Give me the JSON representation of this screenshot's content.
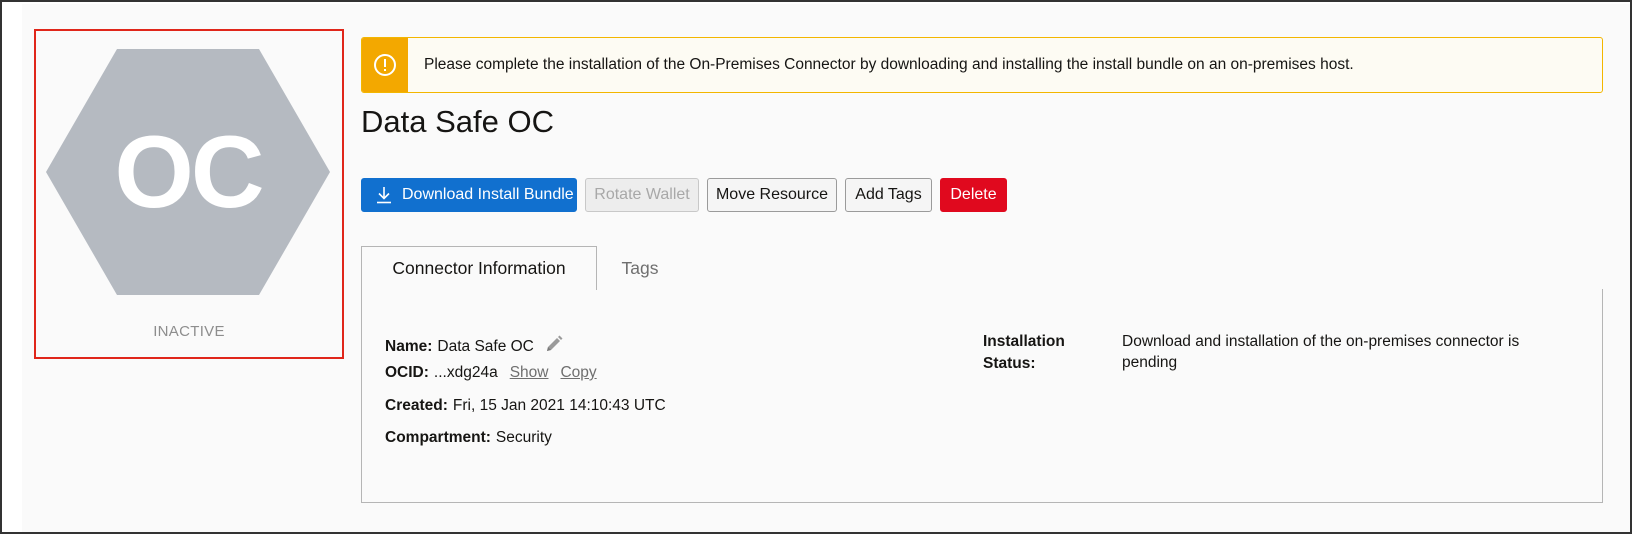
{
  "resource": {
    "initials": "OC",
    "state": "INACTIVE",
    "colors": {
      "hexagon": "#b5bac1",
      "status_border": "#e0261a"
    }
  },
  "banner": {
    "icon": "exclamation-circle-icon",
    "message": "Please complete the installation of the On-Premises Connector by downloading and installing the install bundle on an on-premises host.",
    "colors": {
      "accent": "#f3a800"
    }
  },
  "title": "Data Safe OC",
  "actions": {
    "download_label": "Download Install Bundle",
    "download_icon": "download-icon",
    "rotate_label": "Rotate Wallet",
    "move_label": "Move Resource",
    "tags_label": "Add Tags",
    "delete_label": "Delete",
    "colors": {
      "primary": "#1170cf",
      "danger": "#e0091e"
    }
  },
  "tabs": [
    {
      "label": "Connector Information",
      "active": true
    },
    {
      "label": "Tags",
      "active": false
    }
  ],
  "info": {
    "name_label": "Name:",
    "name_value": "Data Safe OC",
    "edit_icon": "pencil-icon",
    "ocid_label": "OCID:",
    "ocid_value": "...xdg24a",
    "show_label": "Show",
    "copy_label": "Copy",
    "created_label": "Created:",
    "created_value": "Fri, 15 Jan 2021 14:10:43 UTC",
    "compartment_label": "Compartment:",
    "compartment_value": "Security",
    "install_status_label": "Installation Status:",
    "install_status_value": "Download and installation of the on-premises connector is pending"
  }
}
